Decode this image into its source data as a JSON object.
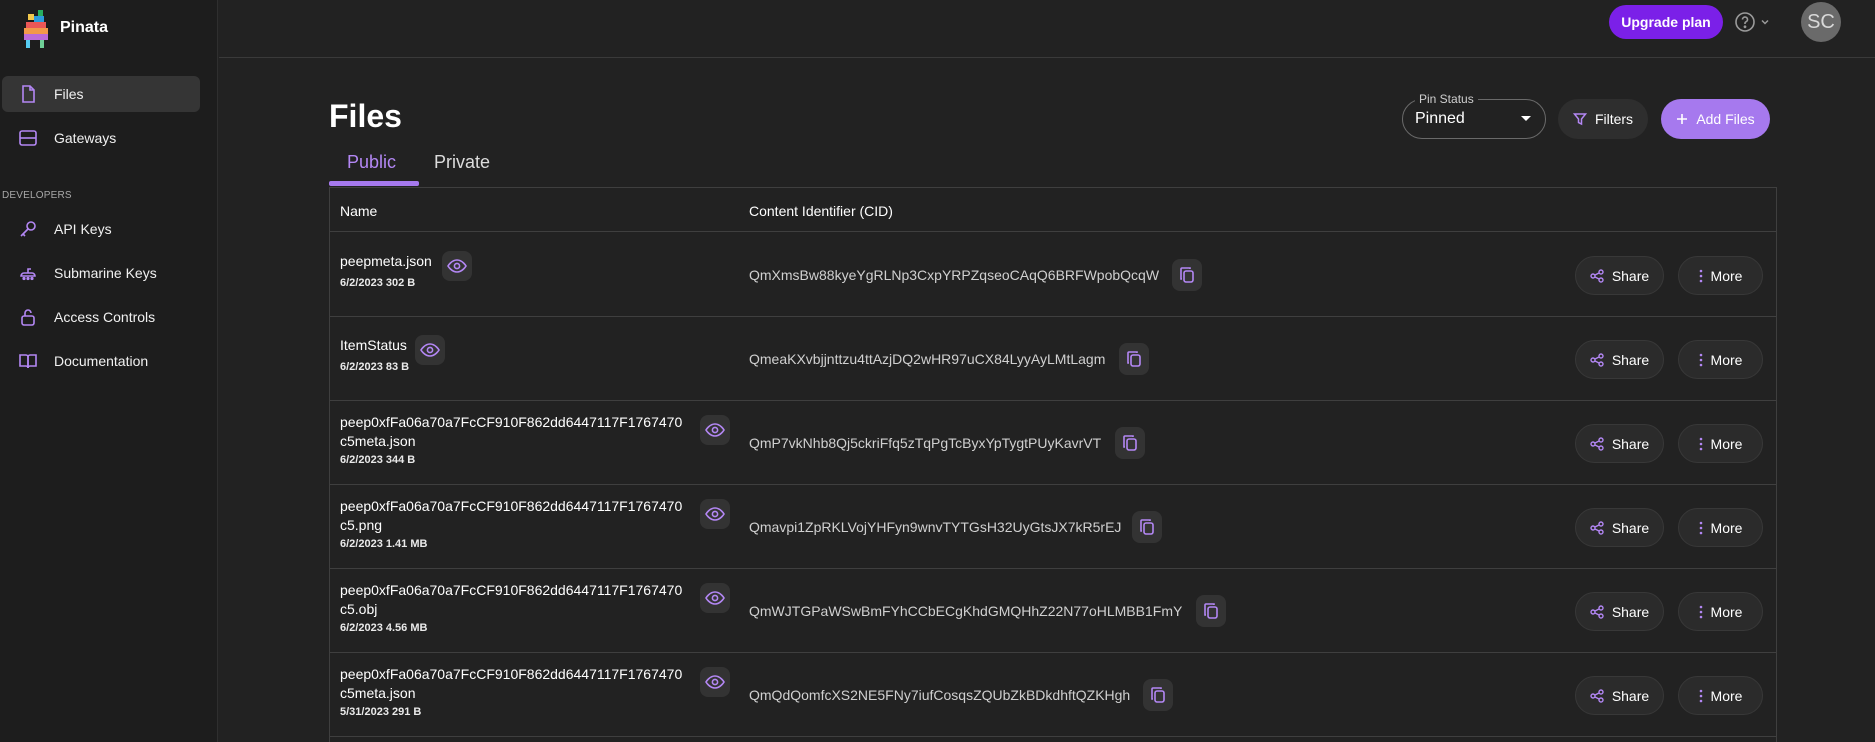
{
  "brand": {
    "name": "Pinata"
  },
  "sidebar": {
    "items": [
      {
        "label": "Files",
        "icon": "file-icon"
      },
      {
        "label": "Gateways",
        "icon": "gateway-icon"
      }
    ],
    "developers_label": "DEVELOPERS",
    "dev_items": [
      {
        "label": "API Keys",
        "icon": "key-icon"
      },
      {
        "label": "Submarine Keys",
        "icon": "submarine-icon"
      },
      {
        "label": "Access Controls",
        "icon": "lock-icon"
      },
      {
        "label": "Documentation",
        "icon": "book-icon"
      }
    ]
  },
  "topbar": {
    "upgrade_label": "Upgrade plan",
    "avatar_initials": "SC"
  },
  "page": {
    "title": "Files",
    "pin_status_label": "Pin Status",
    "pin_status_value": "Pinned",
    "filters_label": "Filters",
    "add_files_label": "Add Files",
    "tabs": [
      "Public",
      "Private"
    ]
  },
  "table": {
    "headers": [
      "Name",
      "Content Identifier (CID)"
    ],
    "share_label": "Share",
    "more_label": "More",
    "rows": [
      {
        "name1": "peepmeta.json",
        "name2": "",
        "meta": "6/2/2023 302 B",
        "cid": "QmXmsBw88kyeYgRLNp3CxpYRPZqseoCAqQ6BRFWpobQcqW"
      },
      {
        "name1": "ItemStatus",
        "name2": "",
        "meta": "6/2/2023 83 B",
        "cid": "QmeaKXvbjjnttzu4ttAzjDQ2wHR97uCX84LyyAyLMtLagm"
      },
      {
        "name1": "peep0xfFa06a70a7FcCF910F862dd6447117F1767470",
        "name2": "c5meta.json",
        "meta": "6/2/2023 344 B",
        "cid": "QmP7vkNhb8Qj5ckriFfq5zTqPgTcByxYpTygtPUyKavrVT"
      },
      {
        "name1": "peep0xfFa06a70a7FcCF910F862dd6447117F1767470",
        "name2": "c5.png",
        "meta": "6/2/2023 1.41 MB",
        "cid": "Qmavpi1ZpRKLVojYHFyn9wnvTYTGsH32UyGtsJX7kR5rEJ"
      },
      {
        "name1": "peep0xfFa06a70a7FcCF910F862dd6447117F1767470",
        "name2": "c5.obj",
        "meta": "6/2/2023 4.56 MB",
        "cid": "QmWJTGPaWSwBmFYhCCbECgKhdGMQHhZ22N77oHLMBB1FmY"
      },
      {
        "name1": "peep0xfFa06a70a7FcCF910F862dd6447117F1767470",
        "name2": "c5meta.json",
        "meta": "5/31/2023 291 B",
        "cid": "QmQdQomfcXS2NE5FNy7iufCosqsZQUbZkBDkdhftQZKHgh"
      }
    ]
  },
  "colors": {
    "accent": "#a679ee",
    "upgrade": "#7b20e8",
    "background": "#222222",
    "sidebar": "#1d1d1d"
  }
}
